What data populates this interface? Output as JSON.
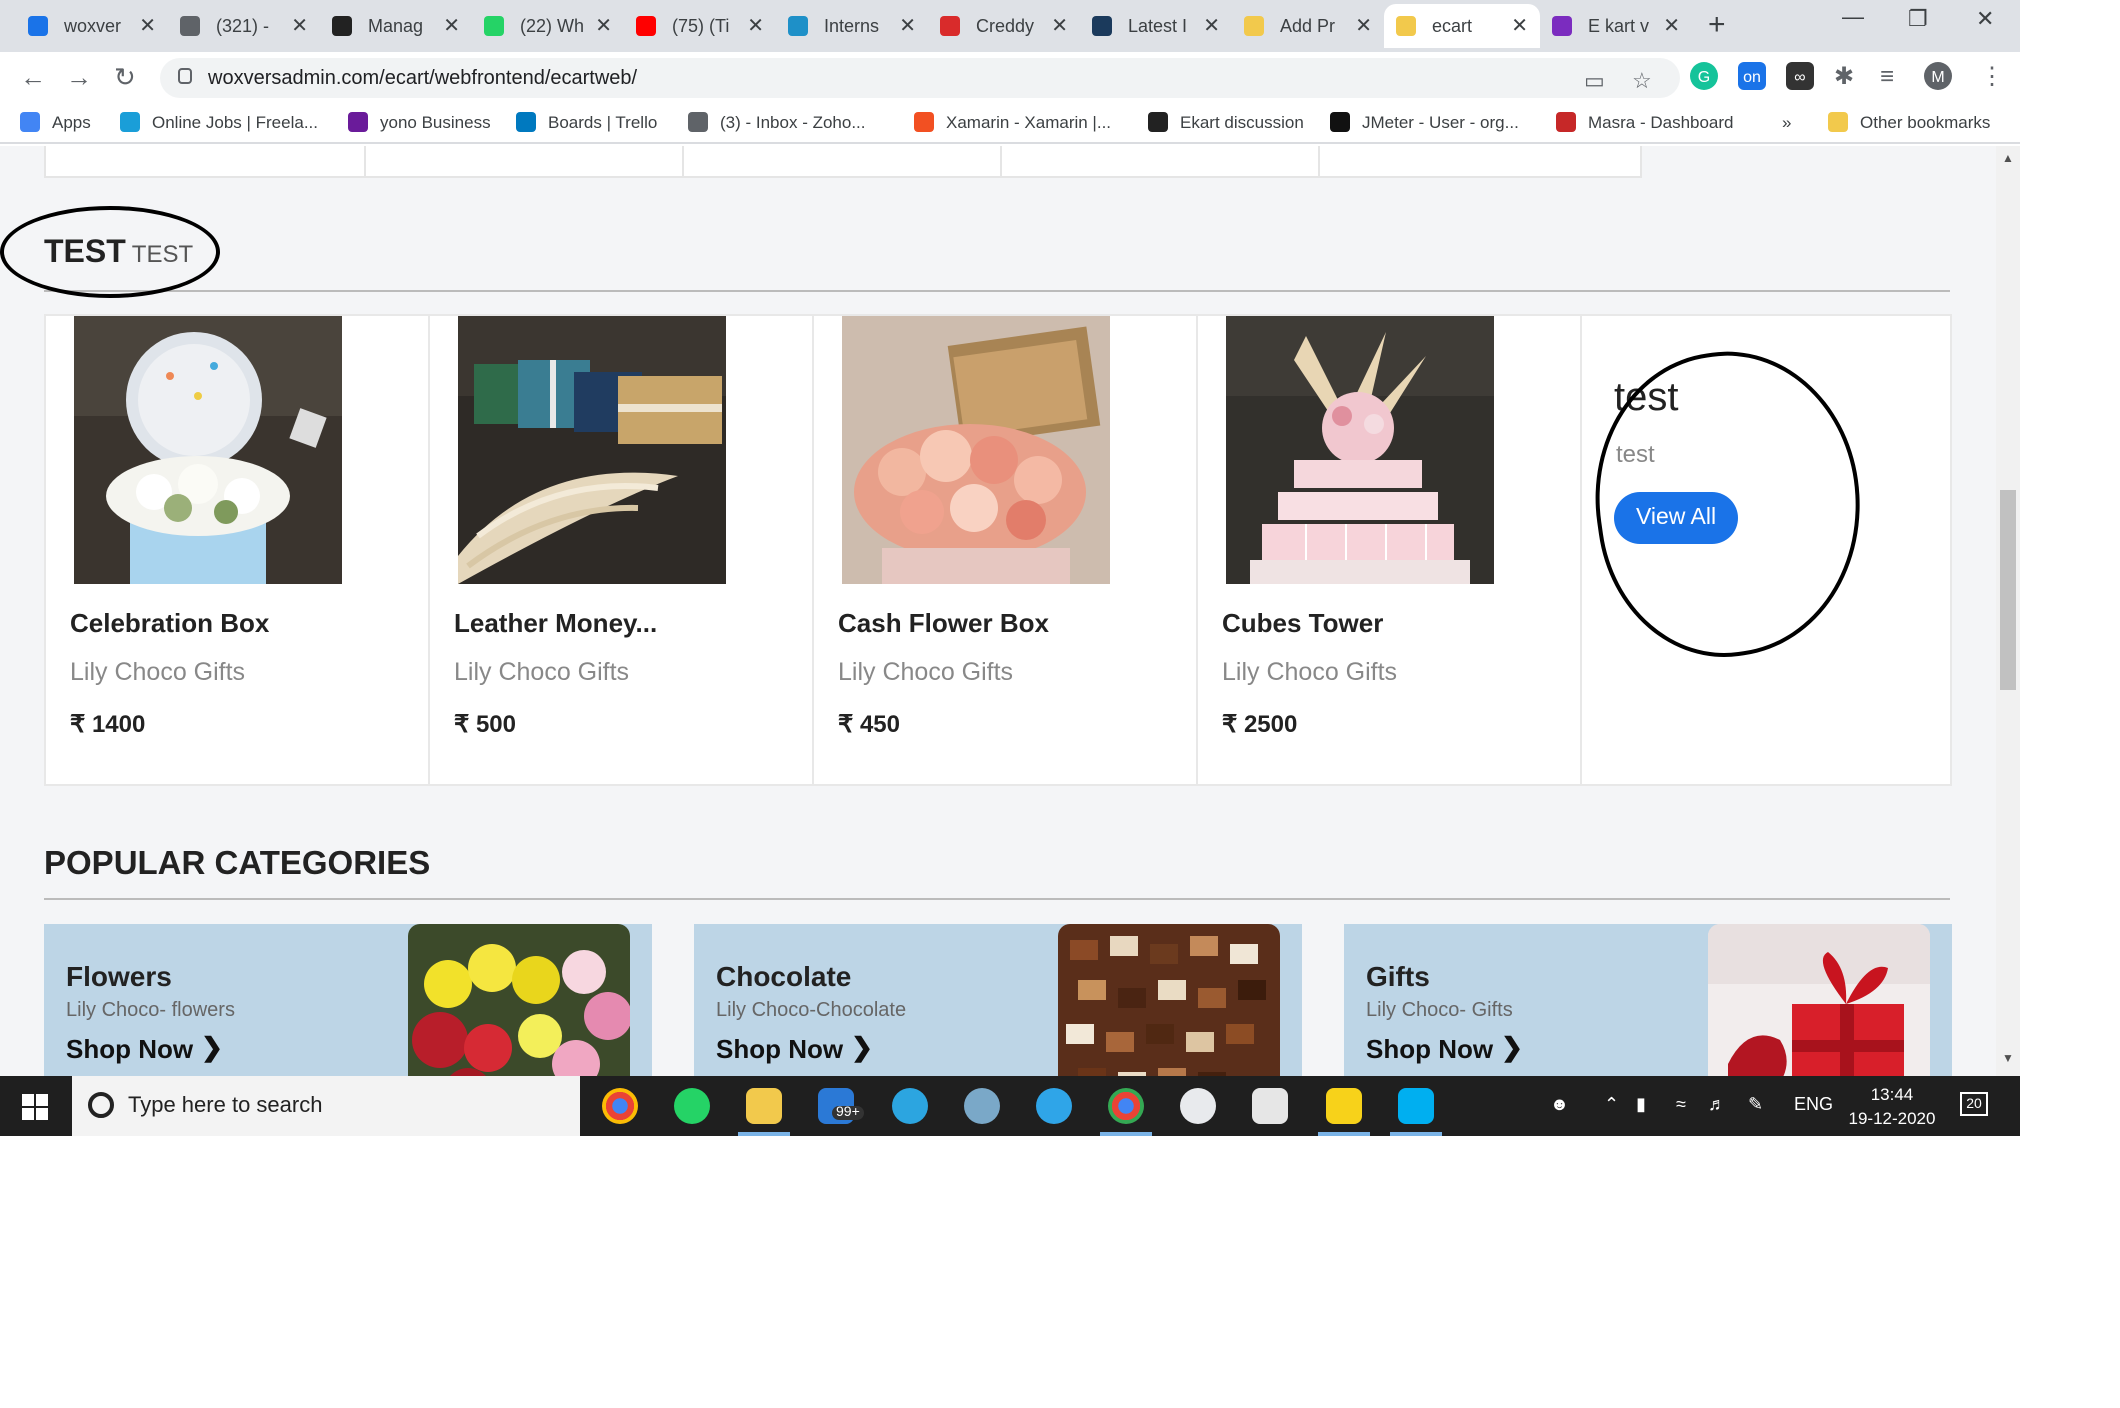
{
  "browser": {
    "tabs": [
      {
        "title": "woxver",
        "color": "#1a73e8"
      },
      {
        "title": "(321) -",
        "color": "#5f6368"
      },
      {
        "title": "Manag",
        "color": "#222222"
      },
      {
        "title": "(22) Wh",
        "color": "#25d366"
      },
      {
        "title": "(75) (Ti",
        "color": "#ff0000"
      },
      {
        "title": "Interns",
        "color": "#1e90c8"
      },
      {
        "title": "Creddy",
        "color": "#d92b2b"
      },
      {
        "title": "Latest I",
        "color": "#1b3a5c"
      },
      {
        "title": "Add Pr",
        "color": "#f2c94c"
      },
      {
        "title": "ecart",
        "color": "#f2c94c",
        "active": true
      },
      {
        "title": "E kart v",
        "color": "#7b2cbf"
      }
    ],
    "url": "woxversadmin.com/ecart/webfrontend/ecartweb/",
    "profile_initial": "M",
    "bookmarks": [
      {
        "label": "Apps",
        "color": "#4285f4"
      },
      {
        "label": "Online Jobs | Freela...",
        "color": "#1a9ed8"
      },
      {
        "label": "yono Business",
        "color": "#6a1b9a"
      },
      {
        "label": "Boards | Trello",
        "color": "#0079bf"
      },
      {
        "label": "(3) - Inbox - Zoho...",
        "color": "#5f6368"
      },
      {
        "label": "Xamarin - Xamarin |...",
        "color": "#f25022"
      },
      {
        "label": "Ekart discussion",
        "color": "#222222"
      },
      {
        "label": "JMeter - User - org...",
        "color": "#111111"
      },
      {
        "label": "Masra - Dashboard",
        "color": "#c62828"
      },
      {
        "label": "Other bookmarks",
        "color": "#f2c94c"
      }
    ],
    "bookmarks_overflow": "»"
  },
  "section": {
    "title": "TEST",
    "subtitle": "TEST"
  },
  "products": [
    {
      "name": "Celebration Box",
      "shop": "Lily Choco Gifts",
      "price": "₹ 1400"
    },
    {
      "name": "Leather Money...",
      "shop": "Lily Choco Gifts",
      "price": "₹ 500"
    },
    {
      "name": "Cash Flower Box",
      "shop": "Lily Choco Gifts",
      "price": "₹ 450"
    },
    {
      "name": "Cubes Tower",
      "shop": "Lily Choco Gifts",
      "price": "₹ 2500"
    }
  ],
  "promo": {
    "title": "test",
    "subtitle": "test",
    "button": "View All"
  },
  "categories_heading": "POPULAR CATEGORIES",
  "categories": [
    {
      "name": "Flowers",
      "sub": "Lily Choco- flowers",
      "cta": "Shop Now"
    },
    {
      "name": "Chocolate",
      "sub": "Lily Choco-Chocolate",
      "cta": "Shop Now"
    },
    {
      "name": "Gifts",
      "sub": "Lily Choco- Gifts",
      "cta": "Shop Now"
    }
  ],
  "taskbar": {
    "search_placeholder": "Type here to search",
    "mail_badge": "99+",
    "language": "ENG",
    "time": "13:44",
    "date": "19-12-2020",
    "notifications": "20"
  }
}
